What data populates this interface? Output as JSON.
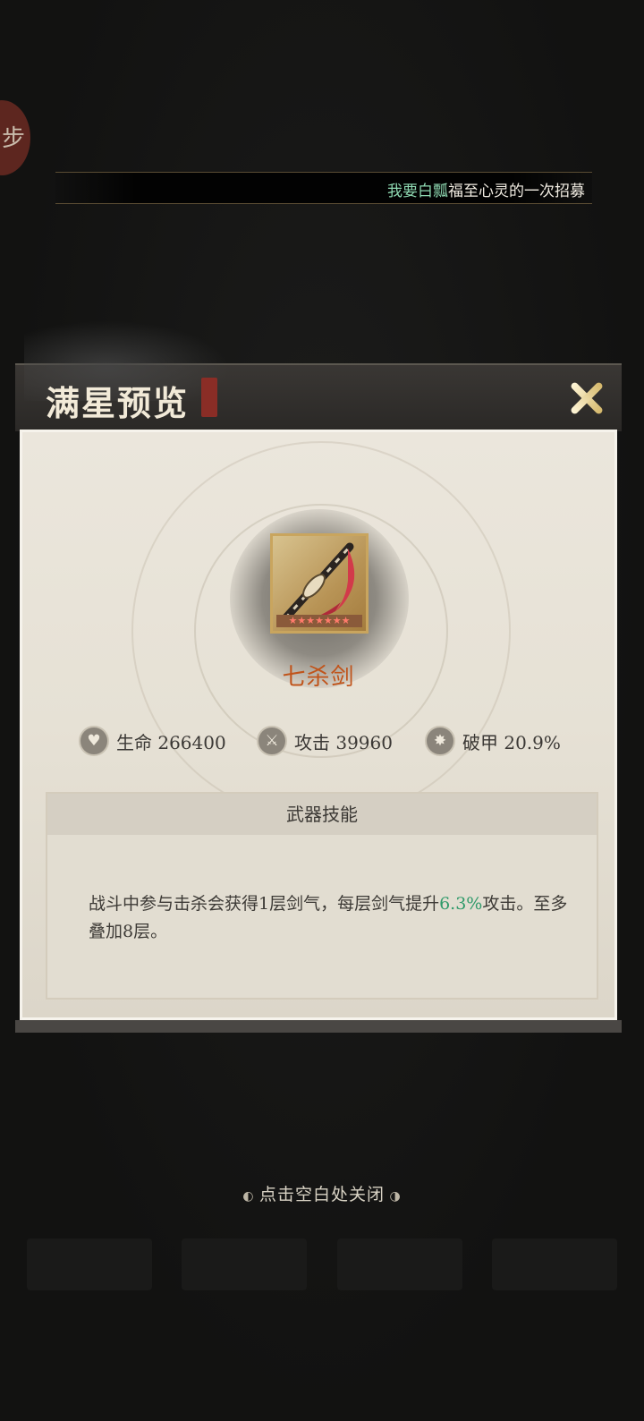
{
  "ticker": {
    "highlight": "我要白瓢",
    "text": "福至心灵的一次招募"
  },
  "modal": {
    "title": "满星预览",
    "close_icon": "close-x-icon"
  },
  "weapon": {
    "name": "七杀剑",
    "star_count": 7,
    "stars": "★★★★★★★"
  },
  "stats": [
    {
      "icon": "heart-icon",
      "label": "生命 266400"
    },
    {
      "icon": "sword-icon",
      "label": "攻击 39960"
    },
    {
      "icon": "shatter-icon",
      "label": "破甲 20.9%"
    }
  ],
  "skill": {
    "header": "武器技能",
    "text_before": "战斗中参与击杀会获得1层剑气，每层剑气提升",
    "highlight": "6.3%",
    "text_after": "攻击。至多叠加8层。"
  },
  "hint": {
    "text": "点击空白处关闭"
  },
  "colors": {
    "accent_orange": "#c0541b",
    "highlight_green": "#2f9a6a",
    "ticker_green": "#8fd9b2"
  }
}
